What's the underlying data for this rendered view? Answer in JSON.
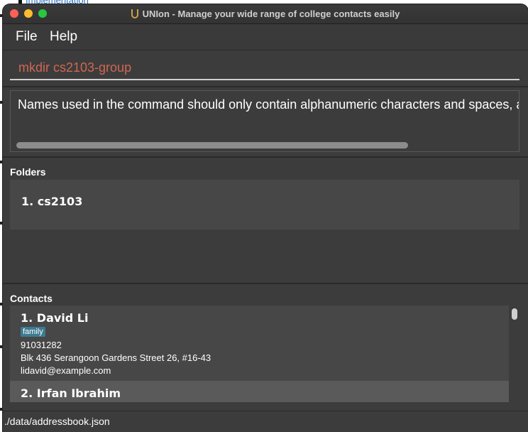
{
  "background": {
    "link_text": "Implementation"
  },
  "window": {
    "title": "UNIon - Manage your wide range of college contacts easily"
  },
  "menu": {
    "file": "File",
    "help": "Help"
  },
  "command": {
    "value": "mkdir cs2103-group"
  },
  "result": {
    "text": "Names used in the command should only contain alphanumeric characters and spaces, and"
  },
  "folders": {
    "label": "Folders",
    "items": [
      {
        "text": "1.  cs2103"
      }
    ]
  },
  "contacts": {
    "label": "Contacts",
    "items": [
      {
        "name": "1.  David Li",
        "tag": "family",
        "phone": "91031282",
        "address": "Blk 436 Serangoon Gardens Street 26, #16-43",
        "email": "lidavid@example.com"
      },
      {
        "name": "2.  Irfan Ibrahim"
      }
    ]
  },
  "status": {
    "path": "./data/addressbook.json"
  },
  "colors": {
    "command_text": "#d06651",
    "tag_bg": "#3e7b91",
    "window_bg": "#3c3c3c"
  }
}
